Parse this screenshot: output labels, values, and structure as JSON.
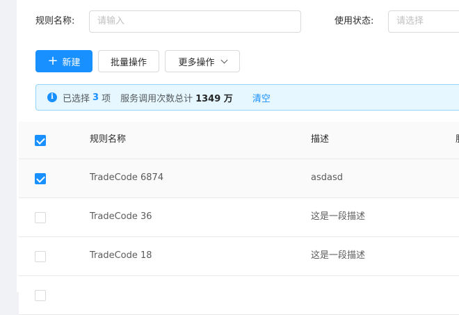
{
  "filters": {
    "rule_name_label": "规则名称:",
    "rule_name_placeholder": "请输入",
    "status_label": "使用状态:",
    "status_placeholder": "请选择"
  },
  "toolbar": {
    "new_label": "新建",
    "batch_label": "批量操作",
    "more_label": "更多操作"
  },
  "alert": {
    "prefix": "已选择",
    "selected_count": "3",
    "unit": "项",
    "calls_label": "服务调用次数总计",
    "calls_value": "1349 万",
    "clear_label": "清空"
  },
  "table": {
    "columns": [
      "规则名称",
      "描述",
      "服"
    ],
    "header_checked": true,
    "rows": [
      {
        "name": "TradeCode 6874",
        "desc": "asdasd",
        "checked": true
      },
      {
        "name": "TradeCode 36",
        "desc": "这是一段描述",
        "checked": false
      },
      {
        "name": "TradeCode 18",
        "desc": "这是一段描述",
        "checked": false
      }
    ]
  },
  "colors": {
    "primary": "#1890ff",
    "alert_bg": "#e6f7ff",
    "alert_border": "#91d5ff"
  }
}
